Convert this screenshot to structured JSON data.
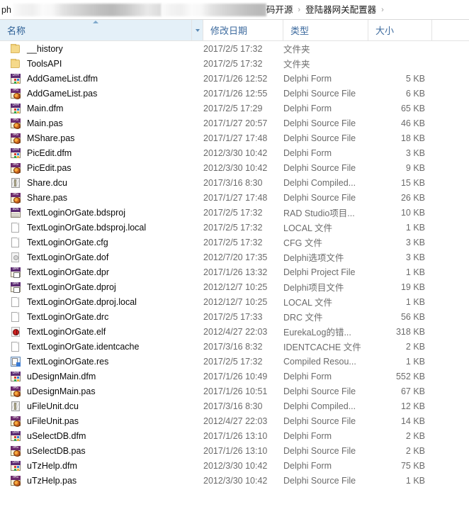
{
  "addressbar": {
    "leading_text": "ph",
    "redacted_segments": 2,
    "crumbs": [
      "码开源",
      "登陆器网关配置器"
    ],
    "separator": "›"
  },
  "columns": {
    "name": "名称",
    "date_modified": "修改日期",
    "type": "类型",
    "size": "大小",
    "sorted_by": "名称",
    "sort_direction": "ascending"
  },
  "files": [
    {
      "icon": "folder-icon",
      "name": "__history",
      "date": "2017/2/5 17:32",
      "type": "文件夹",
      "size": ""
    },
    {
      "icon": "folder-icon",
      "name": "ToolsAPI",
      "date": "2017/2/5 17:32",
      "type": "文件夹",
      "size": ""
    },
    {
      "icon": "dfm-icon",
      "name": "AddGameList.dfm",
      "date": "2017/1/26 12:52",
      "type": "Delphi Form",
      "size": "5 KB"
    },
    {
      "icon": "pas-icon",
      "name": "AddGameList.pas",
      "date": "2017/1/26 12:55",
      "type": "Delphi Source File",
      "size": "6 KB"
    },
    {
      "icon": "dfm-icon",
      "name": "Main.dfm",
      "date": "2017/2/5 17:29",
      "type": "Delphi Form",
      "size": "65 KB"
    },
    {
      "icon": "pas-icon",
      "name": "Main.pas",
      "date": "2017/1/27 20:57",
      "type": "Delphi Source File",
      "size": "46 KB"
    },
    {
      "icon": "pas-icon",
      "name": "MShare.pas",
      "date": "2017/1/27 17:48",
      "type": "Delphi Source File",
      "size": "18 KB"
    },
    {
      "icon": "dfm-icon",
      "name": "PicEdit.dfm",
      "date": "2012/3/30 10:42",
      "type": "Delphi Form",
      "size": "3 KB"
    },
    {
      "icon": "pas-icon",
      "name": "PicEdit.pas",
      "date": "2012/3/30 10:42",
      "type": "Delphi Source File",
      "size": "9 KB"
    },
    {
      "icon": "dcu-icon",
      "name": "Share.dcu",
      "date": "2017/3/16 8:30",
      "type": "Delphi Compiled...",
      "size": "15 KB"
    },
    {
      "icon": "pas-icon",
      "name": "Share.pas",
      "date": "2017/1/27 17:48",
      "type": "Delphi Source File",
      "size": "26 KB"
    },
    {
      "icon": "bds-icon",
      "name": "TextLoginOrGate.bdsproj",
      "date": "2017/2/5 17:32",
      "type": "RAD Studio项目...",
      "size": "10 KB"
    },
    {
      "icon": "page-icon",
      "name": "TextLoginOrGate.bdsproj.local",
      "date": "2017/2/5 17:32",
      "type": "LOCAL 文件",
      "size": "1 KB"
    },
    {
      "icon": "page-icon",
      "name": "TextLoginOrGate.cfg",
      "date": "2017/2/5 17:32",
      "type": "CFG 文件",
      "size": "3 KB"
    },
    {
      "icon": "dof-icon",
      "name": "TextLoginOrGate.dof",
      "date": "2012/7/20 17:35",
      "type": "Delphi选项文件",
      "size": "3 KB"
    },
    {
      "icon": "dpr-icon",
      "name": "TextLoginOrGate.dpr",
      "date": "2017/1/26 13:32",
      "type": "Delphi Project File",
      "size": "1 KB"
    },
    {
      "icon": "dpr-icon",
      "name": "TextLoginOrGate.dproj",
      "date": "2012/12/7 10:25",
      "type": "Delphi项目文件",
      "size": "19 KB"
    },
    {
      "icon": "page-icon",
      "name": "TextLoginOrGate.dproj.local",
      "date": "2012/12/7 10:25",
      "type": "LOCAL 文件",
      "size": "1 KB"
    },
    {
      "icon": "page-icon",
      "name": "TextLoginOrGate.drc",
      "date": "2017/2/5 17:33",
      "type": "DRC 文件",
      "size": "56 KB"
    },
    {
      "icon": "elf-icon",
      "name": "TextLoginOrGate.elf",
      "date": "2012/4/27 22:03",
      "type": "EurekaLog的错...",
      "size": "318 KB"
    },
    {
      "icon": "page-icon",
      "name": "TextLoginOrGate.identcache",
      "date": "2017/3/16 8:32",
      "type": "IDENTCACHE 文件",
      "size": "2 KB"
    },
    {
      "icon": "res-icon",
      "name": "TextLoginOrGate.res",
      "date": "2017/2/5 17:32",
      "type": "Compiled Resou...",
      "size": "1 KB"
    },
    {
      "icon": "dfm-icon",
      "name": "uDesignMain.dfm",
      "date": "2017/1/26 10:49",
      "type": "Delphi Form",
      "size": "552 KB"
    },
    {
      "icon": "pas-icon",
      "name": "uDesignMain.pas",
      "date": "2017/1/26 10:51",
      "type": "Delphi Source File",
      "size": "67 KB"
    },
    {
      "icon": "dcu-icon",
      "name": "uFileUnit.dcu",
      "date": "2017/3/16 8:30",
      "type": "Delphi Compiled...",
      "size": "12 KB"
    },
    {
      "icon": "pas-icon",
      "name": "uFileUnit.pas",
      "date": "2012/4/27 22:03",
      "type": "Delphi Source File",
      "size": "14 KB"
    },
    {
      "icon": "dfm-icon",
      "name": "uSelectDB.dfm",
      "date": "2017/1/26 13:10",
      "type": "Delphi Form",
      "size": "2 KB"
    },
    {
      "icon": "pas-icon",
      "name": "uSelectDB.pas",
      "date": "2017/1/26 13:10",
      "type": "Delphi Source File",
      "size": "2 KB"
    },
    {
      "icon": "dfm-icon",
      "name": "uTzHelp.dfm",
      "date": "2012/3/30 10:42",
      "type": "Delphi Form",
      "size": "75 KB"
    },
    {
      "icon": "pas-icon",
      "name": "uTzHelp.pas",
      "date": "2012/3/30 10:42",
      "type": "Delphi Source File",
      "size": "1 KB"
    }
  ],
  "icon_labels": {
    "dfm": "DFM",
    "pas": "PAS",
    "dpr": "DPR",
    "bds": "BDS"
  },
  "colors": {
    "sorted_header_bg": "#e4f0f8",
    "header_text": "#3c6a9e",
    "secondary_text": "#6b6b6b",
    "folder": "#f5d98a"
  }
}
